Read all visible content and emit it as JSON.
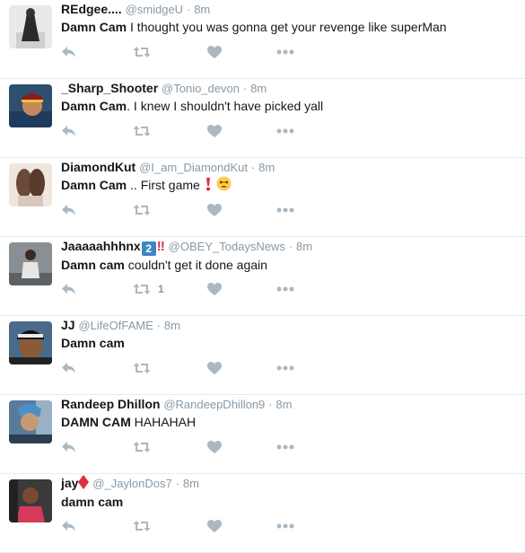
{
  "tweets": [
    {
      "fullname": "REdgee....",
      "username": "@smidgeU",
      "dot": "·",
      "time": "8m",
      "text_bold": "Damn Cam",
      "text_rest": " I thought you was gonna get your revenge like superMan",
      "retweet_count": ""
    },
    {
      "fullname": "_Sharp_Shooter",
      "username": "@Tonio_devon",
      "dot": "·",
      "time": "8m",
      "text_bold": "Damn Cam",
      "text_rest": ". I knew I shouldn't have picked yall",
      "retweet_count": ""
    },
    {
      "fullname": "DiamondKut",
      "username": "@I_am_DiamondKut",
      "dot": "·",
      "time": "8m",
      "text_bold": "Damn Cam",
      "text_rest": " .. First game ",
      "emoji": "exclamation-and-tired-face",
      "retweet_count": ""
    },
    {
      "fullname": "Jaaaaahhhnx",
      "name_keycap": "2",
      "name_bang": "‼",
      "username": "@OBEY_TodaysNews",
      "dot": "·",
      "time": "8m",
      "text_bold": "Damn cam",
      "text_rest": " couldn't get it done again",
      "retweet_count": "1"
    },
    {
      "fullname": "JJ",
      "username": "@LifeOfFAME",
      "dot": "·",
      "time": "8m",
      "text_bold": "Damn cam",
      "text_rest": "",
      "retweet_count": ""
    },
    {
      "fullname": "Randeep Dhillon",
      "username": "@RandeepDhillon9",
      "dot": "·",
      "time": "8m",
      "text_bold": "DAMN CAM",
      "text_rest": " HAHAHAH",
      "retweet_count": ""
    },
    {
      "fullname": "jay",
      "name_emoji": "red-diamond",
      "username": "@_JaylonDos7",
      "dot": "·",
      "time": "8m",
      "text_bold": "damn cam",
      "text_rest": "",
      "retweet_count": ""
    }
  ],
  "colors": {
    "icon": "#aab8c2",
    "muted": "#8899a6",
    "divider": "#e6ecf0"
  }
}
